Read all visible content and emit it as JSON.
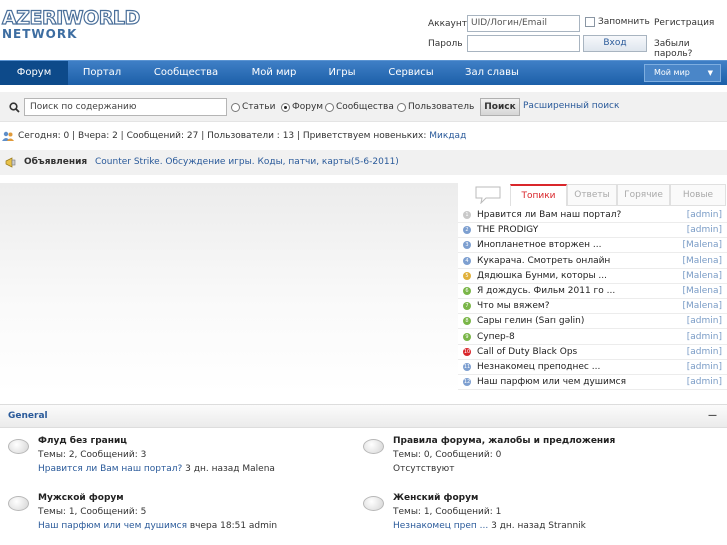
{
  "header": {
    "logo_top": "AZERIWORLD",
    "logo_bottom": "NETWORK",
    "account_label": "Аккаунт",
    "account_placeholder": "UID/Логин/Email",
    "password_label": "Пароль",
    "remember_label": "Запомнить",
    "login_button": "Вход",
    "register_link": "Регистрация",
    "forgot_link": "Забыли пароль?"
  },
  "nav": {
    "items": [
      "Форум",
      "Портал",
      "Сообщества",
      "Мой мир",
      "Игры",
      "Сервисы",
      "Зал славы"
    ],
    "world_dropdown": "Мой мир"
  },
  "search": {
    "placeholder": "Поиск по содержанию",
    "options": [
      "Статьи",
      "Форум",
      "Сообщества",
      "Пользователь"
    ],
    "selected": "Форум",
    "button": "Поиск",
    "advanced": "Расширенный поиск"
  },
  "stats": {
    "text": "Сегодня: 0 | Вчера: 2 | Сообщений: 27 | Пользователи : 13 | Приветствуем новеньких:",
    "newest": "Микдад"
  },
  "announcements": {
    "label": "Объявления",
    "link": "Counter Strike. Обсуждение игры. Коды, патчи, карты(5-6-2011)"
  },
  "topics_tabs": [
    "Топики",
    "Ответы",
    "Горячие",
    "Новые"
  ],
  "topics": [
    {
      "num": "1",
      "title": "Нравится ли Вам наш портал?",
      "author": "[admin]",
      "color": "#c9c9c9"
    },
    {
      "num": "2",
      "title": "THE PRODIGY",
      "author": "[admin]",
      "color": "#7d9fd0"
    },
    {
      "num": "3",
      "title": "Инопланетное вторжен ...",
      "author": "[Malena]",
      "color": "#7d9fd0"
    },
    {
      "num": "4",
      "title": "Кукарача. Смотреть онлайн",
      "author": "[Malena]",
      "color": "#7d9fd0"
    },
    {
      "num": "5",
      "title": "Дядюшка Бунми, которы ...",
      "author": "[Malena]",
      "color": "#e0b03a"
    },
    {
      "num": "6",
      "title": "Я дождусь. Фильм 2011 го ...",
      "author": "[Malena]",
      "color": "#7ab648"
    },
    {
      "num": "7",
      "title": "Что мы вяжем?",
      "author": "[Malena]",
      "color": "#7ab648"
    },
    {
      "num": "8",
      "title": "Сары гелин (Sarı gəlin)",
      "author": "[admin]",
      "color": "#7ab648"
    },
    {
      "num": "9",
      "title": "Супер-8",
      "author": "[admin]",
      "color": "#7ab648"
    },
    {
      "num": "10",
      "title": "Call of Duty Black Ops",
      "author": "[admin]",
      "color": "#d9262b"
    },
    {
      "num": "11",
      "title": "Незнакомец преподнес ...",
      "author": "[admin]",
      "color": "#7d9fd0"
    },
    {
      "num": "12",
      "title": "Наш парфюм или чем душимся",
      "author": "[admin]",
      "color": "#7d9fd0"
    }
  ],
  "general": {
    "title": "General",
    "collapse": "—"
  },
  "forums": [
    {
      "name": "Флуд без границ",
      "stats": "Темы: 2, Сообщений: 3",
      "last_link": "Нравится ли Вам наш портал?",
      "last_rest": " 3 дн. назад Malena"
    },
    {
      "name": "Правила форума, жалобы и предложения",
      "stats": "Темы: 0, Сообщений: 0",
      "last_link": "",
      "last_rest": "Отсутствуют"
    },
    {
      "name": "Мужской форум",
      "stats": "Темы: 1, Сообщений: 5",
      "last_link": "Наш парфюм или чем душимся",
      "last_rest": " вчера 18:51 admin"
    },
    {
      "name": "Женский форум",
      "stats": "Темы: 1, Сообщений: 1",
      "last_link": "Незнакомец преп ...",
      "last_rest": " 3 дн. назад Strannik"
    }
  ]
}
